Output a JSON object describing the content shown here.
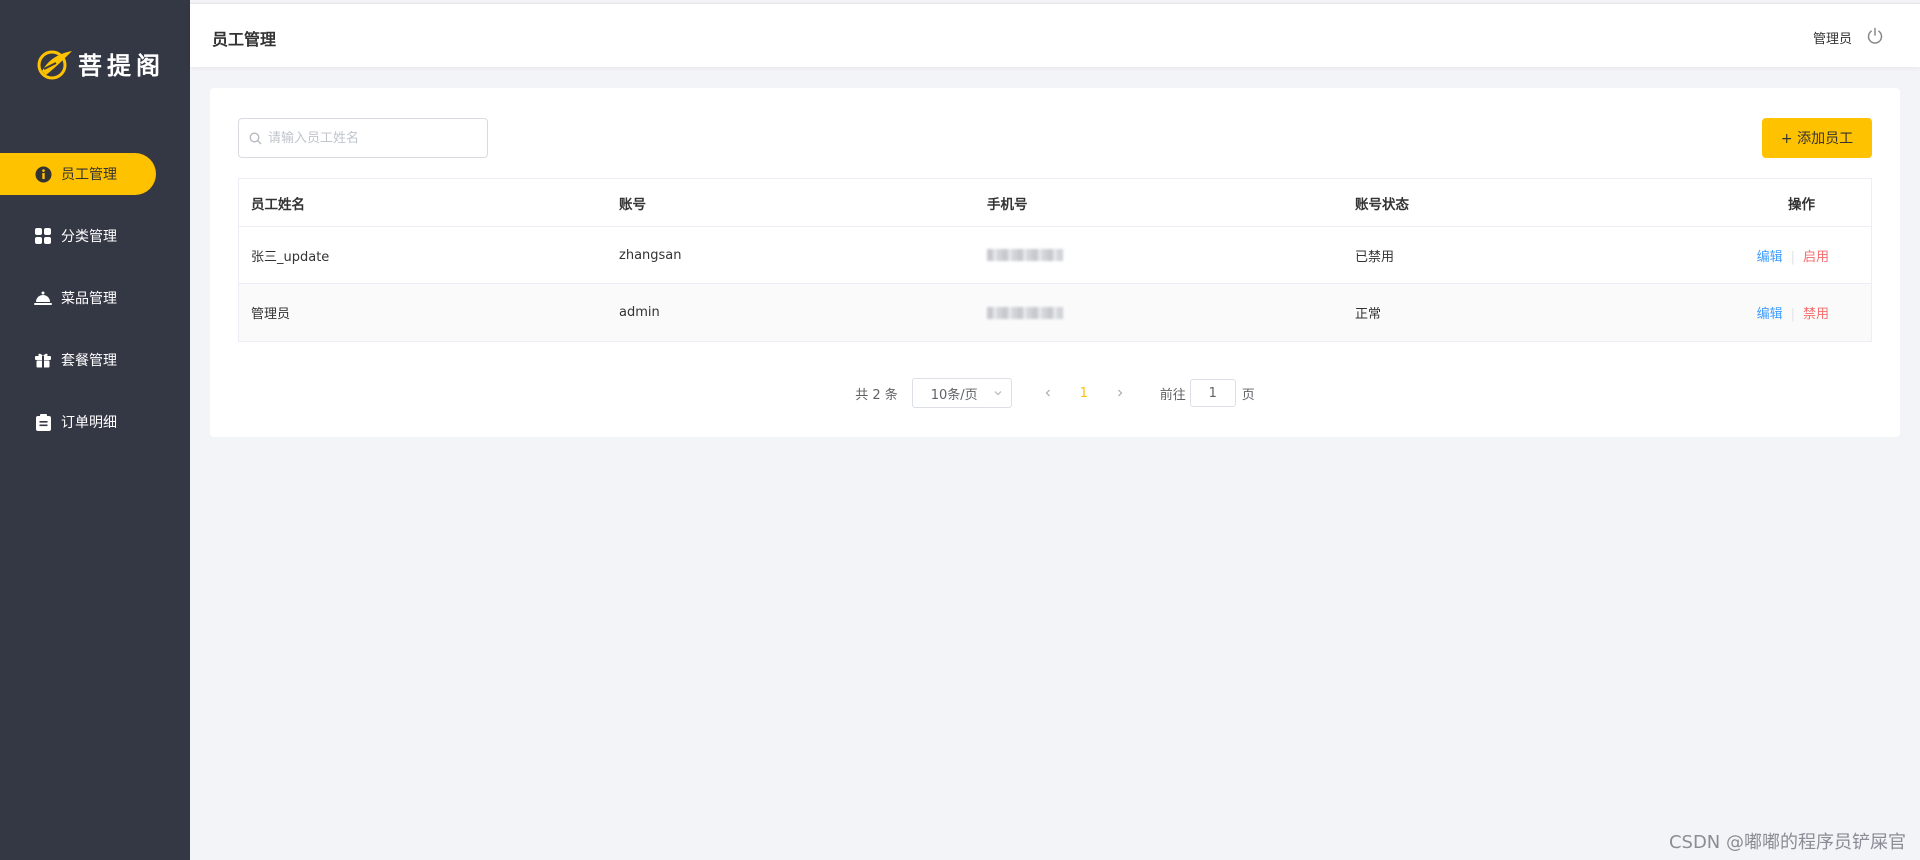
{
  "brand": {
    "logo_text": "菩提阁"
  },
  "sidebar": {
    "items": [
      {
        "label": "员工管理",
        "icon": "info-circle-icon",
        "active": true
      },
      {
        "label": "分类管理",
        "icon": "grid-icon",
        "active": false
      },
      {
        "label": "菜品管理",
        "icon": "cloche-icon",
        "active": false
      },
      {
        "label": "套餐管理",
        "icon": "gift-icon",
        "active": false
      },
      {
        "label": "订单明细",
        "icon": "clipboard-icon",
        "active": false
      }
    ]
  },
  "header": {
    "title": "员工管理",
    "user": "管理员",
    "logout_icon": "power-icon"
  },
  "toolbar": {
    "search_placeholder": "请输入员工姓名",
    "add_label": "+ 添加员工"
  },
  "table": {
    "columns": [
      "员工姓名",
      "账号",
      "手机号",
      "账号状态",
      "操作"
    ],
    "rows": [
      {
        "name": "张三_update",
        "account": "zhangsan",
        "status": "已禁用",
        "edit": "编辑",
        "toggle": "启用"
      },
      {
        "name": "管理员",
        "account": "admin",
        "status": "正常",
        "edit": "编辑",
        "toggle": "禁用"
      }
    ]
  },
  "pagination": {
    "total": "共 2 条",
    "page_size": "10条/页",
    "current_page": "1",
    "goto_prefix": "前往",
    "goto_value": "1",
    "goto_suffix": "页"
  },
  "watermark": "CSDN @嘟嘟的程序员铲屎官",
  "colors": {
    "accent": "#ffc200",
    "sidebar": "#343744",
    "link": "#419eff",
    "danger": "#f56c6c"
  }
}
